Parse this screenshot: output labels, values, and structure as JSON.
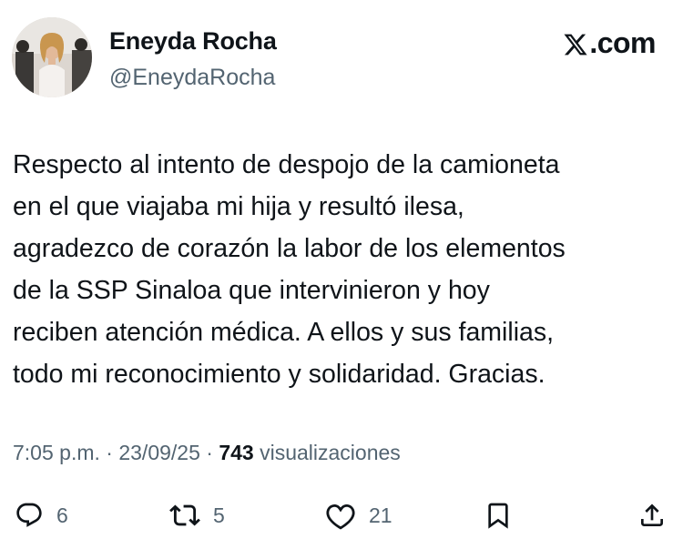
{
  "author": {
    "display_name": "Eneyda Rocha",
    "handle": "@EneydaRocha"
  },
  "brand": {
    "label": ".com",
    "icon": "x-logo-icon"
  },
  "tweet": {
    "lines": [
      "Respecto al intento de despojo de la camioneta",
      "en el que viajaba mi hija y resultó ilesa,",
      "agradezco de corazón la labor de los elementos",
      "de la SSP Sinaloa que intervinieron y hoy",
      "reciben atención médica. A ellos y sus familias,",
      "todo mi reconocimiento y solidaridad. Gracias."
    ]
  },
  "meta": {
    "time": "7:05 p.m.",
    "separator": " · ",
    "date": "23/09/25",
    "views_count": "743",
    "views_label": "visualizaciones"
  },
  "actions": {
    "replies": "6",
    "reposts": "5",
    "likes": "21"
  },
  "colors": {
    "text_primary": "#0f1419",
    "text_secondary": "#536471",
    "background": "#ffffff"
  }
}
